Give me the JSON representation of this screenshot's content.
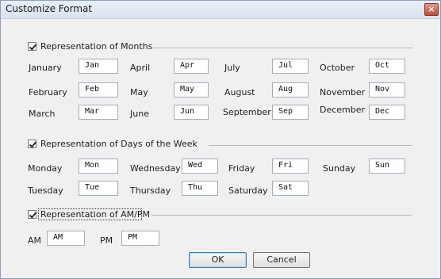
{
  "window": {
    "title": "Customize Format",
    "close_glyph": "×"
  },
  "months": {
    "header": "Representation of Months",
    "checked": true,
    "items": [
      {
        "label": "January",
        "value": "Jan"
      },
      {
        "label": "April",
        "value": "Apr"
      },
      {
        "label": "July",
        "value": "Jul"
      },
      {
        "label": "October",
        "value": "Oct"
      },
      {
        "label": "February",
        "value": "Feb"
      },
      {
        "label": "May",
        "value": "May"
      },
      {
        "label": "August",
        "value": "Aug"
      },
      {
        "label": "November",
        "value": "Nov"
      },
      {
        "label": "March",
        "value": "Mar"
      },
      {
        "label": "June",
        "value": "Jun"
      },
      {
        "label": "September",
        "value": "Sep"
      },
      {
        "label": "December",
        "value": "Dec"
      }
    ]
  },
  "days": {
    "header": "Representation of Days of the Week",
    "checked": true,
    "items": [
      {
        "label": "Monday",
        "value": "Mon"
      },
      {
        "label": "Wednesday",
        "value": "Wed"
      },
      {
        "label": "Friday",
        "value": "Fri"
      },
      {
        "label": "Sunday",
        "value": "Sun"
      },
      {
        "label": "Tuesday",
        "value": "Tue"
      },
      {
        "label": "Thursday",
        "value": "Thu"
      },
      {
        "label": "Saturday",
        "value": "Sat"
      }
    ]
  },
  "ampm": {
    "header": "Representation of AM/PM",
    "checked": true,
    "items": [
      {
        "label": "AM",
        "value": "AM"
      },
      {
        "label": "PM",
        "value": "PM"
      }
    ]
  },
  "buttons": {
    "ok": "OK",
    "cancel": "Cancel"
  }
}
